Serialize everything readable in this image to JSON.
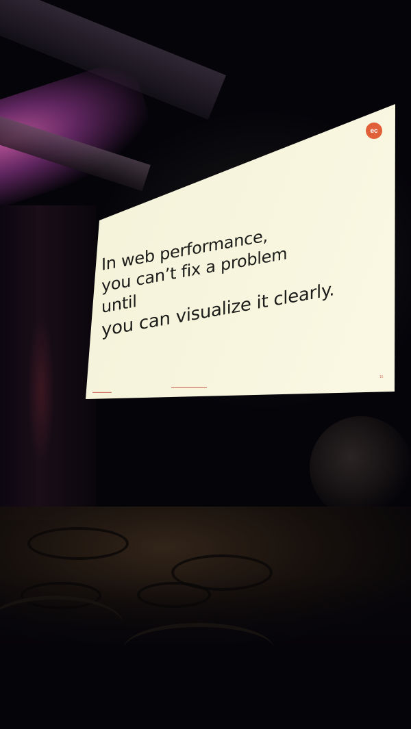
{
  "slide": {
    "lines": [
      "In web performance,",
      "you can’t fix a problem",
      "until",
      "you can visualize it clearly."
    ],
    "logo_text": "ec",
    "page_number": "16"
  },
  "colors": {
    "screen": "#f6f4dc",
    "text": "#1c1c1a",
    "logo": "#e0603a",
    "ceiling_light": "#c85aa4",
    "background": "#050409"
  }
}
